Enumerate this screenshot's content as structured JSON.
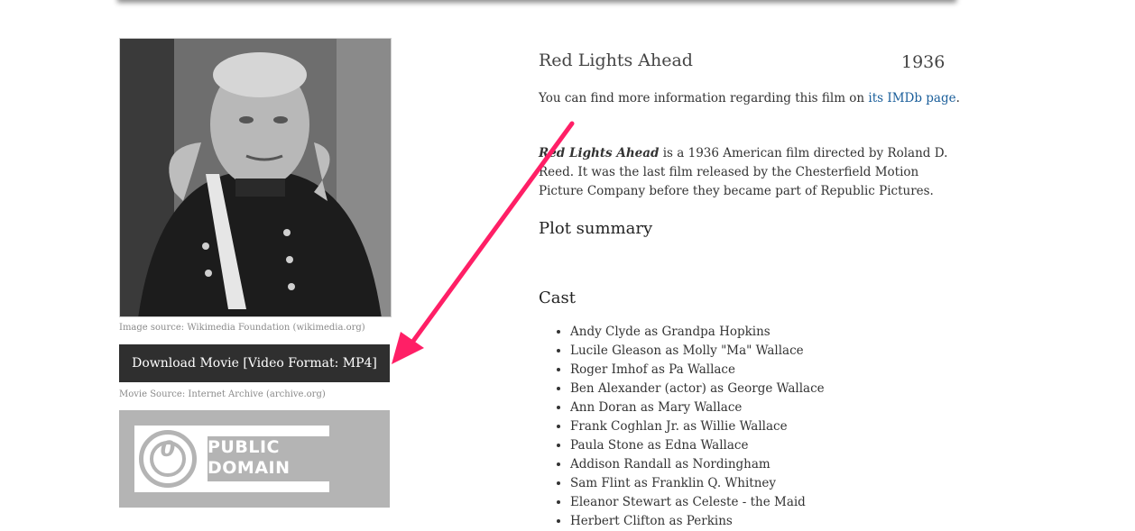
{
  "sidebar": {
    "image_caption": "Image source: Wikimedia Foundation (wikimedia.org)",
    "download_label": "Download Movie [Video Format: MP4]",
    "movie_caption": "Movie Source: Internet Archive (archive.org)",
    "pd_line1": "PUBLIC",
    "pd_line2": "DOMAIN",
    "pd_symbol": "0"
  },
  "film": {
    "title": "Red Lights Ahead",
    "year": "1936",
    "imdb_prefix": "You can find more information regarding this film on ",
    "imdb_link": "its IMDb page",
    "imdb_suffix": ".",
    "intro_bold": "Red Lights Ahead",
    "intro_rest": " is a 1936 American film directed by Roland D. Reed. It was the last film released by the Chesterfield Motion Picture Company before they became part of Republic Pictures."
  },
  "sections": {
    "plot_heading": "Plot summary",
    "cast_heading": "Cast"
  },
  "cast": [
    "Andy Clyde as Grandpa Hopkins",
    "Lucile Gleason as Molly \"Ma\" Wallace",
    "Roger Imhof as Pa Wallace",
    "Ben Alexander (actor) as George Wallace",
    "Ann Doran as Mary Wallace",
    "Frank Coghlan Jr. as Willie Wallace",
    "Paula Stone as Edna Wallace",
    "Addison Randall as Nordingham",
    "Sam Flint as Franklin Q. Whitney",
    "Eleanor Stewart as Celeste - the Maid",
    "Herbert Clifton as Perkins"
  ],
  "colors": {
    "arrow": "#ff1f66",
    "link": "#1a5e9a",
    "button_bg": "#2f2f2f"
  },
  "icons": [
    "public-domain-icon",
    "arrow-annotation"
  ]
}
